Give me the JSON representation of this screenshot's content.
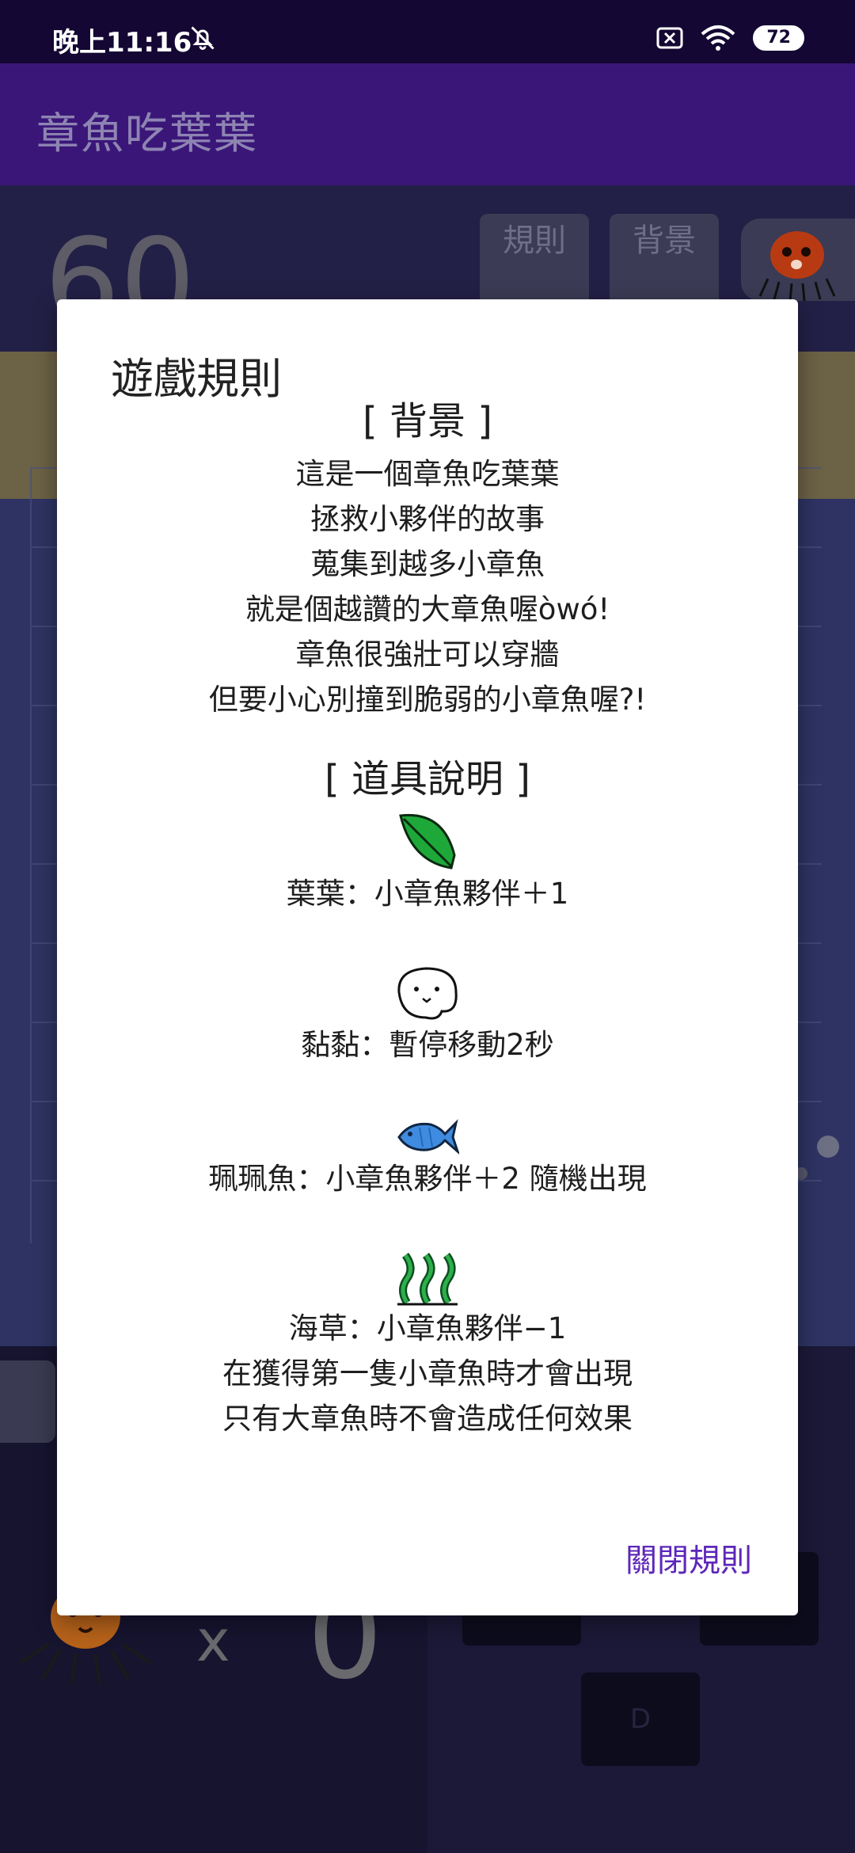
{
  "status_bar": {
    "time": "晚上11:16",
    "battery": "72"
  },
  "app": {
    "title": "章魚吃葉葉"
  },
  "game": {
    "score": "60",
    "rules_button": "規則",
    "background_button": "背景",
    "multiplier": "x",
    "count": "0",
    "dpad_down": "D"
  },
  "dialog": {
    "title": "遊戲規則",
    "background_heading": "[ 背景 ]",
    "background_lines": [
      "這是一個章魚吃葉葉",
      "拯救小夥伴的故事",
      "蒐集到越多小章魚",
      "就是個越讚的大章魚喔òwó!",
      "章魚很強壯可以穿牆",
      "但要小心別撞到脆弱的小章魚喔?!"
    ],
    "items_heading": "[ 道具說明 ]",
    "items": [
      {
        "icon": "leaf-icon",
        "lines": [
          "葉葉：小章魚夥伴＋1"
        ]
      },
      {
        "icon": "slime-icon",
        "lines": [
          "黏黏：暫停移動2秒"
        ]
      },
      {
        "icon": "fish-icon",
        "lines": [
          "珮珮魚：小章魚夥伴＋2 隨機出現"
        ]
      },
      {
        "icon": "seaweed-icon",
        "lines": [
          "海草：小章魚夥伴−1",
          "在獲得第一隻小章魚時才會出現",
          "只有大章魚時不會造成任何效果"
        ]
      }
    ],
    "close_label": "關閉規則"
  }
}
